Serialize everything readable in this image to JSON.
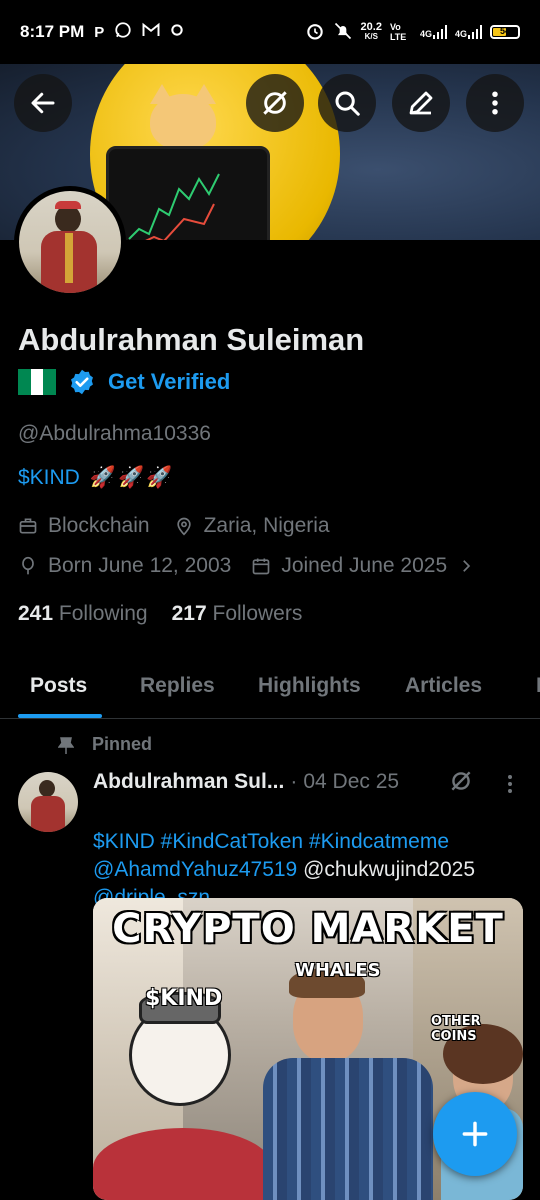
{
  "status_bar": {
    "time": "8:17 PM",
    "app_icons": [
      "P",
      "whatsapp-icon",
      "gmail-icon",
      "sync-icon"
    ],
    "net_speed_value": "20.2",
    "net_speed_unit": "K/S",
    "vo_lte": "Vo LTE",
    "signal1": "4G",
    "signal2": "4G",
    "battery": "54"
  },
  "profile": {
    "name": "Abdulrahman Suleiman",
    "get_verified": "Get Verified",
    "handle": "@Abdulrahma10336",
    "bio_ticker": "$KIND",
    "bio_emoji": "🚀🚀🚀",
    "category": "Blockchain",
    "location": "Zaria, Nigeria",
    "born": "Born June 12, 2003",
    "joined": "Joined June 2025",
    "following_count": "241",
    "following_label": "Following",
    "followers_count": "217",
    "followers_label": "Followers"
  },
  "tabs": [
    "Posts",
    "Replies",
    "Highlights",
    "Articles",
    "M"
  ],
  "active_tab": "Posts",
  "post": {
    "pinned_label": "Pinned",
    "author": "Abdulrahman Sul...",
    "separator": "·",
    "date": "04 Dec 25",
    "text_line1": "$KIND #KindCatToken #Kindcatmeme",
    "text_line2_link": "@AhamdYahuz47519",
    "text_line2_plain": " @chukwujind2025",
    "text_line3": "@driple_szn",
    "meme_title": "CRYPTO MARKET",
    "meme_label_kind": "$KIND",
    "meme_label_whales": "WHALES",
    "meme_label_other": "OTHER COINS"
  },
  "colors": {
    "accent": "#1d9bf0",
    "muted": "#71767b",
    "text": "#e7e9ea",
    "background": "#000000"
  }
}
